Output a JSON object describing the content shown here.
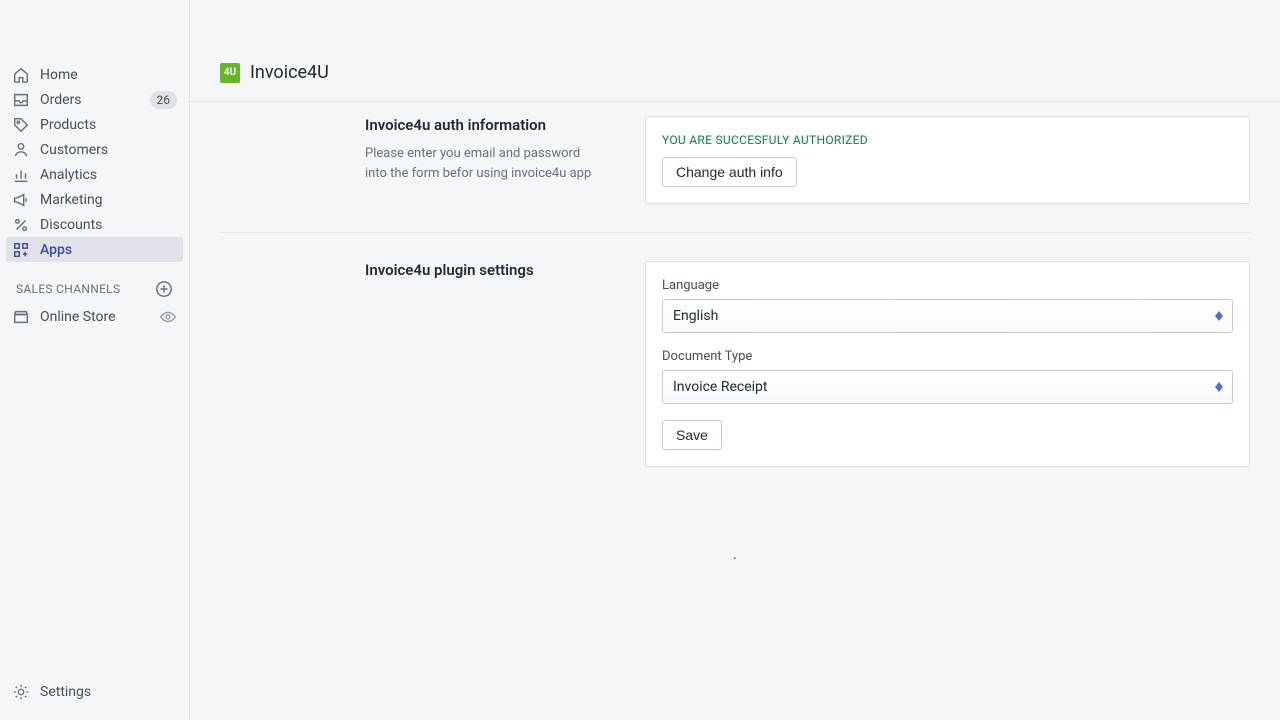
{
  "sidebar": {
    "items": [
      {
        "label": "Home"
      },
      {
        "label": "Orders",
        "badge": "26"
      },
      {
        "label": "Products"
      },
      {
        "label": "Customers"
      },
      {
        "label": "Analytics"
      },
      {
        "label": "Marketing"
      },
      {
        "label": "Discounts"
      },
      {
        "label": "Apps"
      }
    ],
    "section_title": "SALES CHANNELS",
    "channels": [
      {
        "label": "Online Store"
      }
    ],
    "settings_label": "Settings"
  },
  "header": {
    "app_icon_text": "4U",
    "app_title": "Invoice4U"
  },
  "auth_section": {
    "title": "Invoice4u auth information",
    "description": "Please enter you email and password into the form befor using invoice4u app",
    "status": "YOU ARE SUCCESFULY AUTHORIZED",
    "button_label": "Change auth info"
  },
  "settings_section": {
    "title": "Invoice4u plugin settings",
    "language_label": "Language",
    "language_value": "English",
    "doctype_label": "Document Type",
    "doctype_value": "Invoice Receipt",
    "save_label": "Save"
  }
}
